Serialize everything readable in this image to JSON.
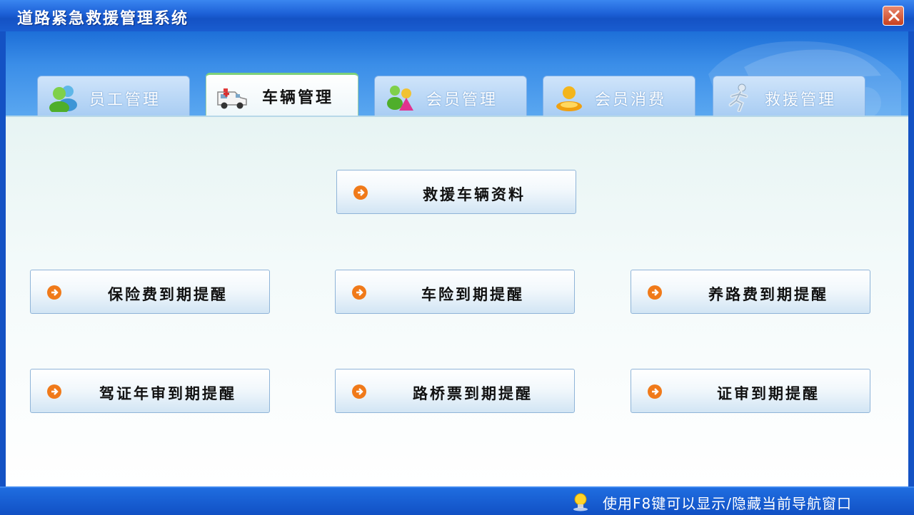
{
  "window": {
    "title": "道路紧急救援管理系统"
  },
  "tabs": [
    {
      "label": "员工管理",
      "icon": "staff-icon",
      "active": false
    },
    {
      "label": "车辆管理",
      "icon": "ambulance-icon",
      "active": true
    },
    {
      "label": "会员管理",
      "icon": "members-icon",
      "active": false
    },
    {
      "label": "会员消费",
      "icon": "member-consume-icon",
      "active": false
    },
    {
      "label": "救援管理",
      "icon": "runner-icon",
      "active": false
    }
  ],
  "buttons": [
    {
      "label": "救援车辆资料"
    },
    {
      "label": "保险费到期提醒"
    },
    {
      "label": "车险到期提醒"
    },
    {
      "label": "养路费到期提醒"
    },
    {
      "label": "驾证年审到期提醒"
    },
    {
      "label": "路桥票到期提醒"
    },
    {
      "label": "证审到期提醒"
    }
  ],
  "status": {
    "text": "使用F8键可以显示/隐藏当前导航窗口"
  },
  "colors": {
    "titlebar": "#1c5fd6",
    "accent_green": "#7ed07a",
    "arrow_orange": "#f07a1a",
    "close_red": "#c8401e"
  }
}
